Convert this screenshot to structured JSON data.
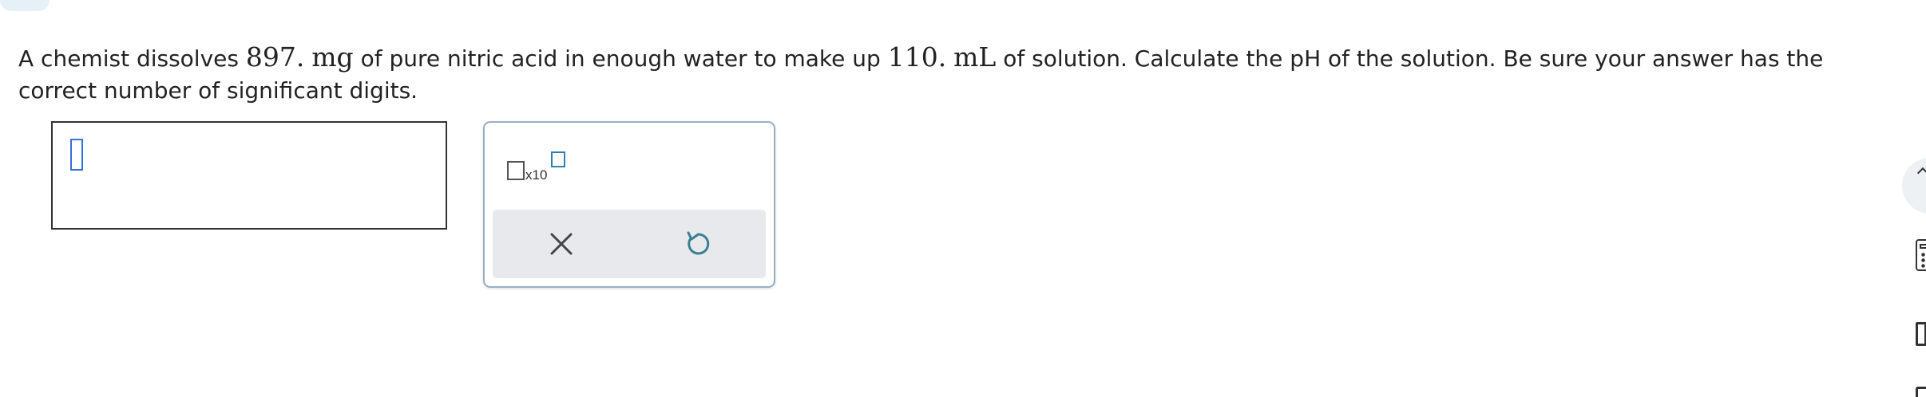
{
  "question": {
    "part1": "A chemist dissolves ",
    "mass_value": "897.",
    "mass_unit": "mg",
    "part2": " of pure nitric acid in enough water to make up ",
    "volume_value": "110.",
    "volume_unit": "mL",
    "part3": " of solution. Calculate the pH of the solution. Be sure your answer has the correct number of significant digits."
  },
  "answer": {
    "value": ""
  },
  "toolbox": {
    "sci_notation_label": "x10"
  },
  "colors": {
    "caret": "#3a6fd8",
    "exponent_box": "#2f7fb0",
    "toolbox_border": "#9ab0c2",
    "action_bar_bg": "#e7e9ec"
  },
  "icons": {
    "clear": "close-icon",
    "undo": "undo-icon",
    "side_top": "chevron-up-icon",
    "side_calculator": "calculator-icon",
    "side_periodic": "panel-icon"
  }
}
